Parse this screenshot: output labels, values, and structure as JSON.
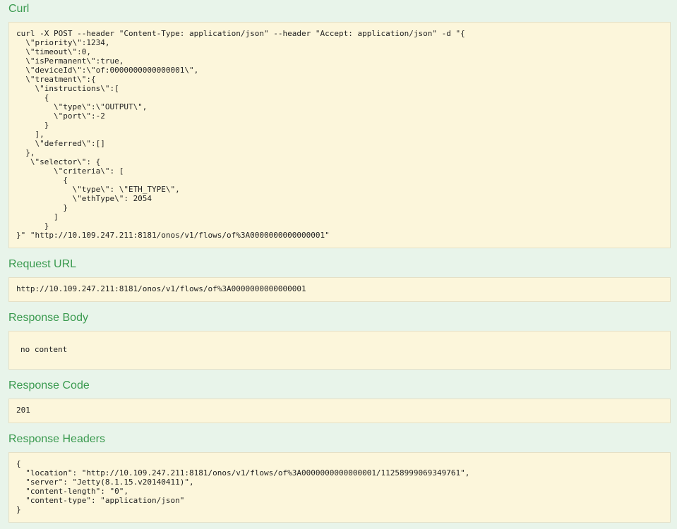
{
  "curl": {
    "title": "Curl",
    "command": "curl -X POST --header \"Content-Type: application/json\" --header \"Accept: application/json\" -d \"{\n  \\\"priority\\\":1234,\n  \\\"timeout\\\":0,\n  \\\"isPermanent\\\":true,\n  \\\"deviceId\\\":\\\"of:0000000000000001\\\",\n  \\\"treatment\\\":{\n    \\\"instructions\\\":[\n      {\n        \\\"type\\\":\\\"OUTPUT\\\",\n        \\\"port\\\":-2\n      }\n    ],\n    \\\"deferred\\\":[]\n  },\n   \\\"selector\\\": {\n        \\\"criteria\\\": [\n          {\n            \\\"type\\\": \\\"ETH_TYPE\\\",\n            \\\"ethType\\\": 2054\n          }\n        ]\n      }\n}\" \"http://10.109.247.211:8181/onos/v1/flows/of%3A0000000000000001\""
  },
  "request_url": {
    "title": "Request URL",
    "value": "http://10.109.247.211:8181/onos/v1/flows/of%3A0000000000000001"
  },
  "response_body": {
    "title": "Response Body",
    "value": "no content"
  },
  "response_code": {
    "title": "Response Code",
    "value": "201"
  },
  "response_headers": {
    "title": "Response Headers",
    "value": "{\n  \"location\": \"http://10.109.247.211:8181/onos/v1/flows/of%3A0000000000000001/11258999069349761\",\n  \"server\": \"Jetty(8.1.15.v20140411)\",\n  \"content-length\": \"0\",\n  \"content-type\": \"application/json\"\n}"
  },
  "colors": {
    "page_background": "#e8f4ea",
    "section_title": "#3a9a4f",
    "block_background": "#fcf6db"
  }
}
